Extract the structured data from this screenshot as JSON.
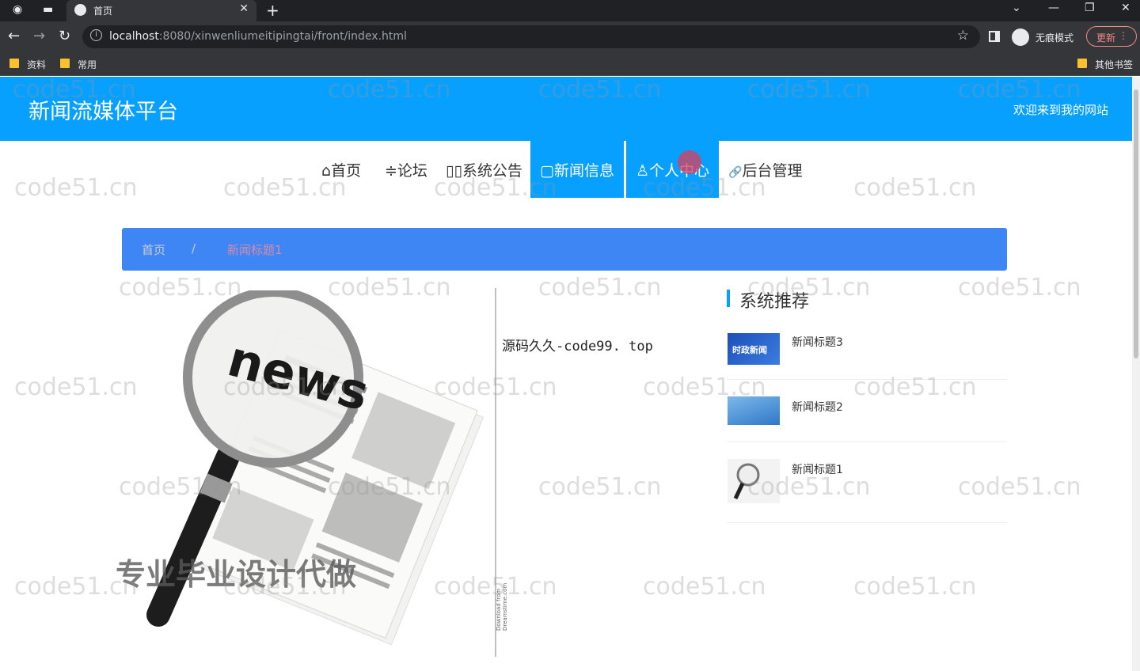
{
  "browser": {
    "tab_title": "首页",
    "url_host": "localhost",
    "url_rest": ":8080/xinwenliumeitipingtai/front/index.html",
    "incognito_label": "无痕模式",
    "update_label": "更新",
    "bookmarks": [
      "资料",
      "常用"
    ],
    "other_bookmarks": "其他书签"
  },
  "header": {
    "site_title": "新闻流媒体平台",
    "welcome": "欢迎来到我的网站"
  },
  "nav": {
    "items": [
      {
        "icon": "⌂",
        "label": "首页"
      },
      {
        "icon": "≑",
        "label": "论坛"
      },
      {
        "icon": "▯▯",
        "label": "系统公告"
      },
      {
        "icon": "▢",
        "label": "新闻信息"
      },
      {
        "icon": "♙",
        "label": "个人中心"
      },
      {
        "icon": "🔗",
        "label": "后台管理"
      }
    ]
  },
  "breadcrumb": {
    "home": "首页",
    "separator": "/",
    "current": "新闻标题1"
  },
  "article": {
    "image_caption": "专业毕业设计代做",
    "title": "源码久久-code99. top",
    "vertical_watermark": "Download from Dreamstime.com"
  },
  "recommend": {
    "heading": "系统推荐",
    "items": [
      {
        "title": "新闻标题3",
        "thumb": "时政新闻"
      },
      {
        "title": "新闻标题2",
        "thumb": ""
      },
      {
        "title": "新闻标题1",
        "thumb": ""
      }
    ]
  },
  "watermark_text": "code51.cn",
  "colors": {
    "header": "#08a0ff",
    "breadcrumb": "#3f86f5"
  }
}
